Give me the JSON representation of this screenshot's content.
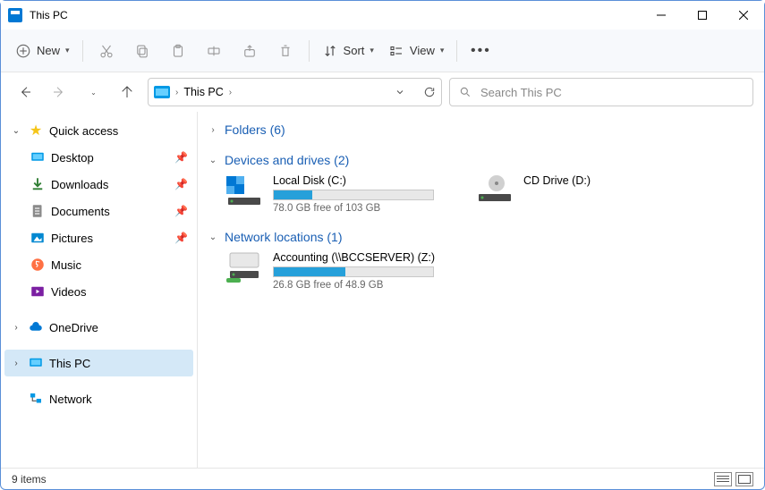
{
  "window": {
    "title": "This PC"
  },
  "toolbar": {
    "new_label": "New",
    "sort_label": "Sort",
    "view_label": "View"
  },
  "address": {
    "crumbs": [
      "This PC"
    ]
  },
  "search": {
    "placeholder": "Search This PC"
  },
  "sidebar": {
    "quick_access": {
      "label": "Quick access",
      "expanded": true
    },
    "items": [
      {
        "label": "Desktop",
        "pinned": true,
        "icon": "desktop"
      },
      {
        "label": "Downloads",
        "pinned": true,
        "icon": "downloads"
      },
      {
        "label": "Documents",
        "pinned": true,
        "icon": "documents"
      },
      {
        "label": "Pictures",
        "pinned": true,
        "icon": "pictures"
      },
      {
        "label": "Music",
        "pinned": false,
        "icon": "music"
      },
      {
        "label": "Videos",
        "pinned": false,
        "icon": "videos"
      }
    ],
    "onedrive": {
      "label": "OneDrive",
      "expanded": false
    },
    "this_pc": {
      "label": "This PC",
      "expanded": false,
      "selected": true
    },
    "network": {
      "label": "Network"
    }
  },
  "sections": {
    "folders": {
      "label": "Folders (6)",
      "expanded": false
    },
    "devices": {
      "label": "Devices and drives (2)",
      "expanded": true
    },
    "network": {
      "label": "Network locations (1)",
      "expanded": true
    }
  },
  "drives": [
    {
      "name": "Local Disk (C:)",
      "sub": "78.0 GB free of 103 GB",
      "fill_pct": 24,
      "type": "hdd"
    },
    {
      "name": "CD Drive (D:)",
      "sub": "",
      "fill_pct": null,
      "type": "cd"
    }
  ],
  "network_drives": [
    {
      "name": "Accounting (\\\\BCCSERVER) (Z:)",
      "sub": "26.8 GB free of 48.9 GB",
      "fill_pct": 45,
      "type": "net"
    }
  ],
  "status": {
    "items": "9 items"
  }
}
